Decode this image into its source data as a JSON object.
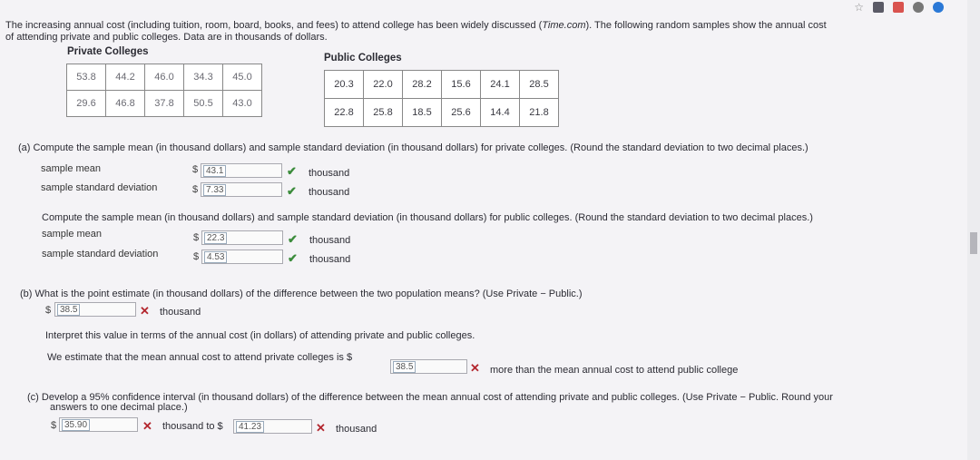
{
  "intro": {
    "line1_a": "The increasing annual cost (including tuition, room, board, books, and fees) to attend college has been widely discussed (",
    "line1_source": "Time.com",
    "line1_b": "). The following random samples show the annual cost",
    "line2": "of attending private and public colleges. Data are in thousands of dollars."
  },
  "private": {
    "title": "Private Colleges",
    "rows": [
      [
        "53.8",
        "44.2",
        "46.0",
        "34.3",
        "45.0"
      ],
      [
        "29.6",
        "46.8",
        "37.8",
        "50.5",
        "43.0"
      ]
    ]
  },
  "public": {
    "title": "Public Colleges",
    "rows": [
      [
        "20.3",
        "22.0",
        "28.2",
        "15.6",
        "24.1",
        "28.5"
      ],
      [
        "22.8",
        "25.8",
        "18.5",
        "25.6",
        "14.4",
        "21.8"
      ]
    ]
  },
  "part_a": {
    "prompt_private": "(a)  Compute the sample mean (in thousand dollars) and sample standard deviation (in thousand dollars) for private colleges. (Round the standard deviation to two decimal places.)",
    "mean_label": "sample mean",
    "sd_label": "sample standard deviation",
    "private_mean": "43.1",
    "private_sd": "7.33",
    "prompt_public": "Compute the sample mean (in thousand dollars) and sample standard deviation (in thousand dollars) for public colleges. (Round the standard deviation to two decimal places.)",
    "public_mean": "22.3",
    "public_sd": "4.53"
  },
  "part_b": {
    "prompt": "(b)  What is the point estimate (in thousand dollars) of the difference between the two population means? (Use Private − Public.)",
    "answer": "38.5",
    "interpret": "Interpret this value in terms of the annual cost (in dollars) of attending private and public colleges.",
    "estimate_a": "We estimate that the mean annual cost to attend private colleges is $",
    "estimate_value": "38.5",
    "estimate_b": "more than the mean annual cost to attend public college"
  },
  "part_c": {
    "prompt1": "(c)  Develop a 95% confidence interval (in thousand dollars) of the difference between the mean annual cost of attending private and public colleges. (Use Private − Public. Round your",
    "prompt2": "answers to one decimal place.)",
    "lower": "35.90",
    "to_text": "thousand to $",
    "upper": "41.23"
  },
  "common": {
    "dollar": "$",
    "thousand": "thousand",
    "check": "✔",
    "cross": "✕"
  },
  "colors": {
    "correct": "#3c8c3c",
    "incorrect": "#b3262e"
  }
}
